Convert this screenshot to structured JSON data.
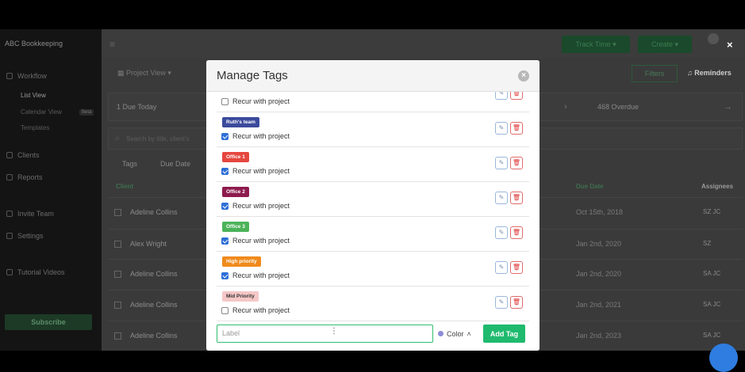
{
  "app": {
    "brand": "ABC Bookkeeping",
    "header": {
      "track_time": "Track Time",
      "create": "Create",
      "close": "×"
    },
    "sidebar": {
      "workflow": "Workflow",
      "list_view": "List View",
      "calendar_view": "Calendar View",
      "beta": "Beta",
      "templates": "Templates",
      "clients": "Clients",
      "reports": "Reports",
      "invite_team": "Invite Team",
      "settings": "Settings",
      "tutorial_videos": "Tutorial Videos",
      "subscribe": "Subscribe"
    },
    "toolbar": {
      "project_view": "Project View",
      "filters": "Filters",
      "reminders": "Reminders"
    },
    "due": {
      "today": "1  Due Today",
      "overdue": "468  Overdue"
    },
    "search_placeholder": "Search by title, client's",
    "filter_chips": [
      "Tags",
      "Due Date"
    ],
    "table": {
      "col_client": "Client",
      "col_due": "Due Date",
      "col_assignees": "Assignees",
      "rows": [
        {
          "name": "Adeline Collins",
          "due": "Oct 15th, 2018",
          "assignees": "SZ  JC"
        },
        {
          "name": "Alex Wright",
          "due": "Jan 2nd, 2020",
          "assignees": "SZ"
        },
        {
          "name": "Adeline Collins",
          "due": "Jan 2nd, 2020",
          "assignees": "SA  JC"
        },
        {
          "name": "Adeline Collins",
          "due": "Jan 2nd, 2021",
          "assignees": "SA  JC"
        },
        {
          "name": "Adeline Collins",
          "due": "Jan 2nd, 2023",
          "assignees": "SA  JC"
        }
      ]
    }
  },
  "modal": {
    "title": "Manage Tags",
    "recur_label": "Recur with project",
    "tags": [
      {
        "name": "",
        "color": "#ffffff",
        "recur": false
      },
      {
        "name": "Ruth's team",
        "color": "#3b4a9c",
        "recur": true
      },
      {
        "name": "Office 1",
        "color": "#e5473f",
        "recur": true
      },
      {
        "name": "Office 2",
        "color": "#8e1b4e",
        "recur": true
      },
      {
        "name": "Office 3",
        "color": "#4cb35a",
        "recur": true
      },
      {
        "name": "High priority",
        "color": "#f08a1c",
        "recur": true
      },
      {
        "name": "Mid Priority",
        "color": "#f6c7c7",
        "recur": false
      }
    ],
    "footer": {
      "label_placeholder": "Label",
      "color_label": "Color",
      "add_tag": "Add Tag"
    }
  }
}
